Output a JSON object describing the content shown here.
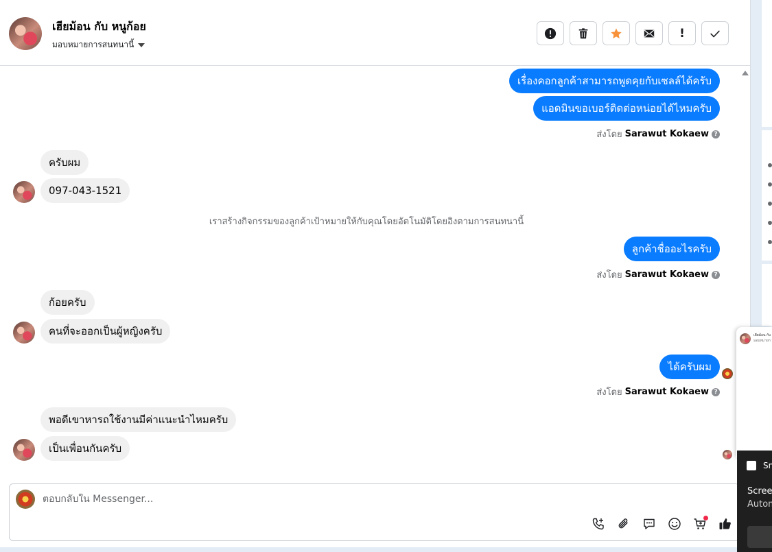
{
  "header": {
    "title": "เฮียม้อน กับ หนูก้อย",
    "assign_label": "มอบหมายการสนทนานี้",
    "actions": [
      {
        "icon": "alert-circle-icon"
      },
      {
        "icon": "trash-icon"
      },
      {
        "icon": "star-icon",
        "color": "#f7923b"
      },
      {
        "icon": "envelope-icon"
      },
      {
        "icon": "exclamation-icon",
        "label": "!"
      },
      {
        "icon": "check-icon"
      }
    ]
  },
  "thread": {
    "messages": [
      {
        "dir": "out",
        "text": "เรื่องคอกลูกค้าสามารถพูดคุยกับเซลล์ได้ครับ"
      },
      {
        "dir": "out",
        "text": "แอดมินขอเบอร์ติดต่อหน่อยได้ไหมครับ"
      },
      {
        "type": "sent_by",
        "prefix": "ส่งโดย",
        "name": "Sarawut Kokaew"
      },
      {
        "dir": "in",
        "text": "ครับผม"
      },
      {
        "dir": "in",
        "text": "097-043-1521"
      },
      {
        "type": "system",
        "text": "เราสร้างกิจกรรมของลูกค้าเป้าหมายให้กับคุณโดยอัตโนมัติโดยอิงตามการสนทนานี้"
      },
      {
        "dir": "out",
        "text": "ลูกค้าชื่ออะไรครับ"
      },
      {
        "type": "sent_by",
        "prefix": "ส่งโดย",
        "name": "Sarawut Kokaew"
      },
      {
        "dir": "in",
        "text": "ก้อยครับ"
      },
      {
        "dir": "in",
        "text": "คนที่จะออกเป็นผู้หญิงครับ"
      },
      {
        "dir": "out",
        "text": "ได้ครับผม"
      },
      {
        "type": "sent_by",
        "prefix": "ส่งโดย",
        "name": "Sarawut Kokaew"
      },
      {
        "dir": "in",
        "text": "พอดีเขาหารถใช้งานมีค่าแนะนำไหมครับ"
      },
      {
        "dir": "in",
        "text": "เป็นเพื่อนกันครับ"
      }
    ],
    "help_glyph": "?"
  },
  "composer": {
    "placeholder": "ตอบกลับใน Messenger...",
    "value": "",
    "tools": [
      "phone-add-icon",
      "paperclip-icon",
      "quick-reply-icon",
      "emoji-icon",
      "shop-cart-icon",
      "thumbs-up-icon"
    ],
    "accent": "#0a7cff"
  },
  "overlays": {
    "popup_title": "เฮียม้อน กับ",
    "popup_sub": "มอบหมายการสนทนา",
    "toast_app": "Sn",
    "toast_title": "Screen",
    "toast_body": "Autom"
  }
}
